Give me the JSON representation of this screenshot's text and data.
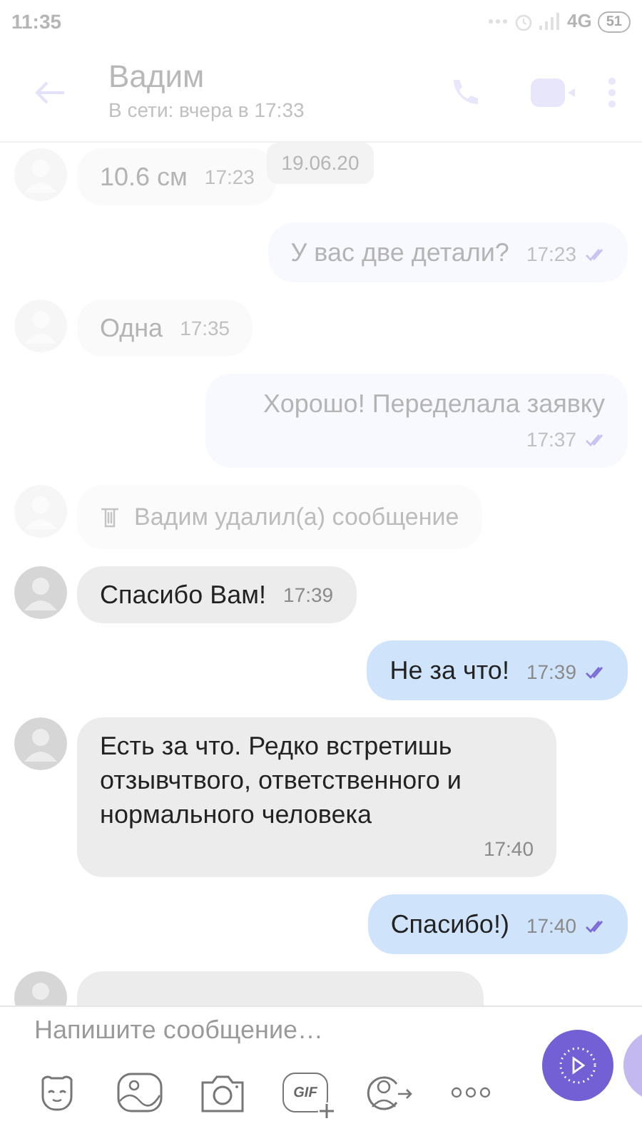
{
  "status_bar": {
    "time": "11:35",
    "network": "4G",
    "battery": "51"
  },
  "header": {
    "name": "Вадим",
    "status": "В сети: вчера в 17:33"
  },
  "date_badge": "19.06.20",
  "messages": [
    {
      "kind": "incoming",
      "text": "10.6 см",
      "time": "17:23",
      "dimmed": true
    },
    {
      "kind": "outgoing",
      "text": "У вас две детали?",
      "time": "17:23",
      "read": true,
      "dimmed": true
    },
    {
      "kind": "incoming",
      "text": "Одна",
      "time": "17:35",
      "dimmed": true
    },
    {
      "kind": "outgoing",
      "text": "Хорошо! Переделала заявку",
      "time": "17:37",
      "read": true,
      "dimmed": true
    },
    {
      "kind": "deleted",
      "text": "Вадим удалил(а) сообщение",
      "dimmed": true
    },
    {
      "kind": "incoming",
      "text": "Спасибо Вам!",
      "time": "17:39",
      "dimmed": false
    },
    {
      "kind": "outgoing",
      "text": "Не за что!",
      "time": "17:39",
      "read": true,
      "dimmed": false
    },
    {
      "kind": "incoming",
      "text": "Есть за что. Редко встретишь отзывчтвого,  ответственного и нормального человека",
      "time": "17:40",
      "dimmed": false
    },
    {
      "kind": "outgoing",
      "text": "Спасибо!)",
      "time": "17:40",
      "read": true,
      "dimmed": false
    },
    {
      "kind": "partial",
      "dimmed": false
    }
  ],
  "composer": {
    "placeholder": "Напишите сообщение…",
    "gif_label": "GIF"
  }
}
